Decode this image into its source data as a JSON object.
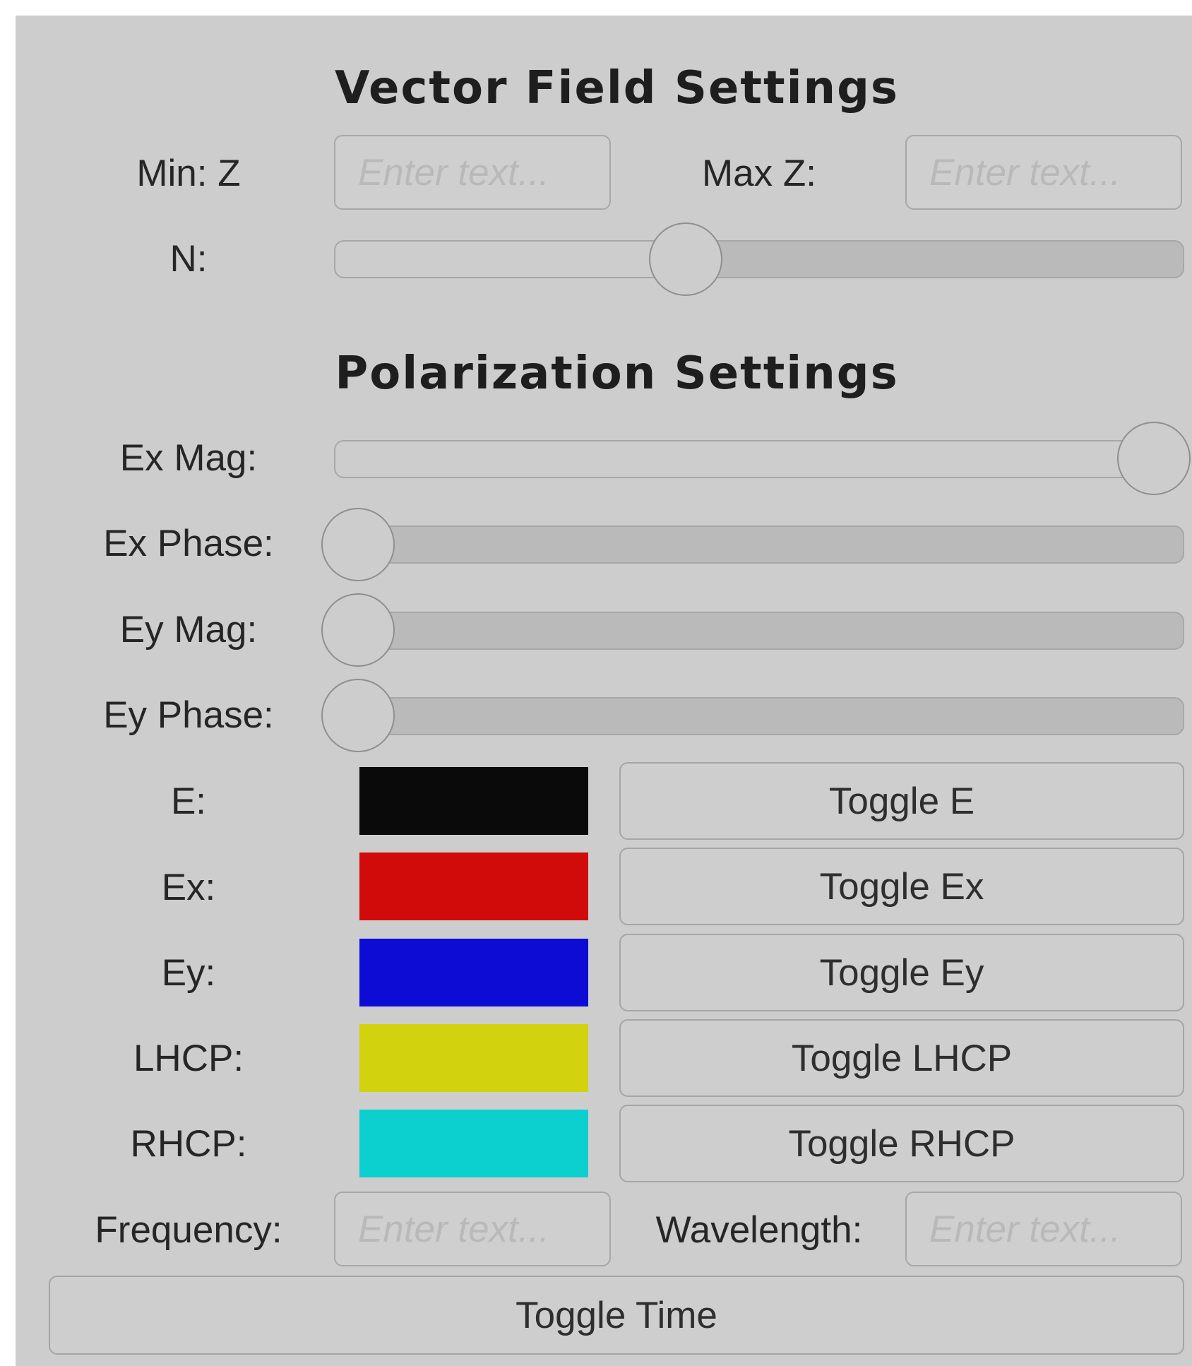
{
  "vector_field": {
    "title": "Vector Field Settings",
    "min_z_label": "Min: Z",
    "min_z_placeholder": "Enter text...",
    "max_z_label": "Max Z:",
    "max_z_placeholder": "Enter text...",
    "n_label": "N:",
    "n_slider_fraction": 0.4
  },
  "polarization": {
    "title": "Polarization Settings",
    "sliders": [
      {
        "label": "Ex Mag:",
        "fraction": 1.0
      },
      {
        "label": "Ex Phase:",
        "fraction": 0.0
      },
      {
        "label": "Ey Mag:",
        "fraction": 0.0
      },
      {
        "label": "Ey Phase:",
        "fraction": 0.0
      }
    ],
    "colors": [
      {
        "label": "E:",
        "color": "#0a0a0a",
        "button": "Toggle E"
      },
      {
        "label": "Ex:",
        "color": "#d10a0a",
        "button": "Toggle Ex"
      },
      {
        "label": "Ey:",
        "color": "#0c0cd4",
        "button": "Toggle Ey"
      },
      {
        "label": "LHCP:",
        "color": "#d2d20e",
        "button": "Toggle LHCP"
      },
      {
        "label": "RHCP:",
        "color": "#0cd0d0",
        "button": "Toggle RHCP"
      }
    ],
    "frequency_label": "Frequency:",
    "frequency_placeholder": "Enter text...",
    "wavelength_label": "Wavelength:",
    "wavelength_placeholder": "Enter text...",
    "toggle_time": "Toggle Time"
  }
}
